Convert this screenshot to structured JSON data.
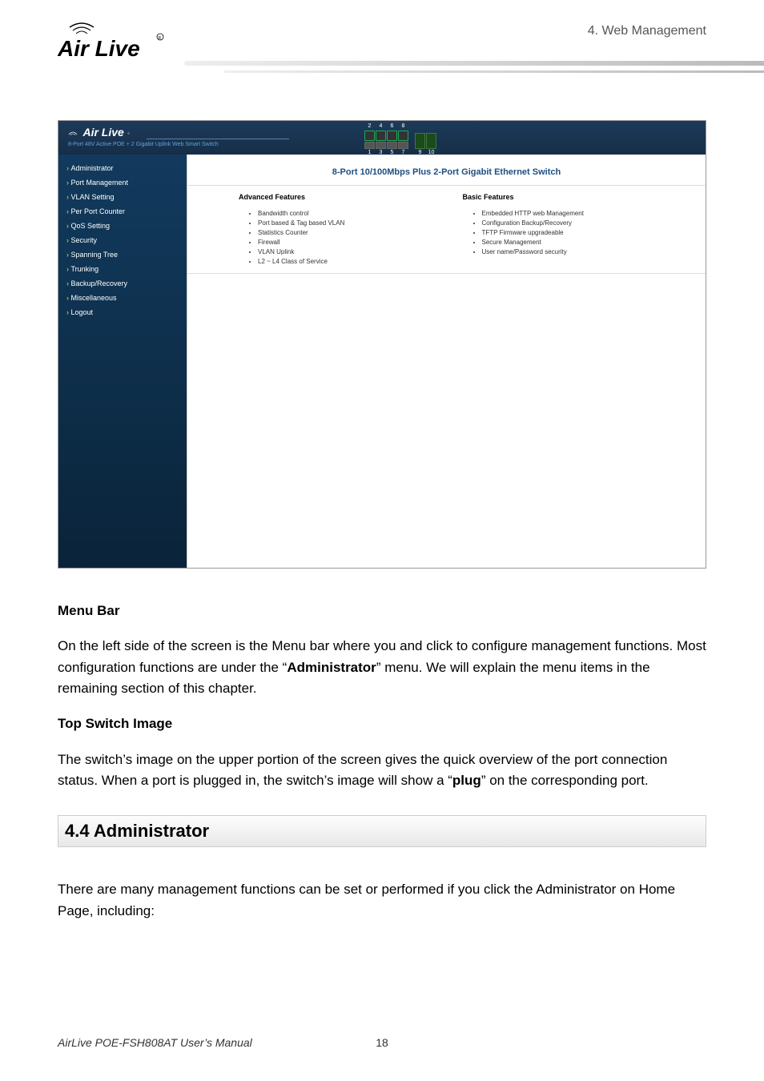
{
  "page_header": {
    "chapter": "4.  Web  Management",
    "logo_alt": "Air Live"
  },
  "screenshot": {
    "header": {
      "brand": "Air Live",
      "subtitle": "8-Port 48V Active POE + 2 Gigabit Uplink Web Smart Switch",
      "port_labels_top": [
        "2",
        "4",
        "6",
        "8"
      ],
      "port_labels_bottom": [
        "1",
        "3",
        "5",
        "7"
      ],
      "uplink_labels": [
        "9",
        "10"
      ]
    },
    "sidebar": {
      "items": [
        {
          "label": "Administrator"
        },
        {
          "label": "Port Management"
        },
        {
          "label": "VLAN Setting"
        },
        {
          "label": "Per Port Counter"
        },
        {
          "label": "QoS Setting"
        },
        {
          "label": "Security"
        },
        {
          "label": "Spanning Tree"
        },
        {
          "label": "Trunking"
        },
        {
          "label": "Backup/Recovery"
        },
        {
          "label": "Miscellaneous"
        },
        {
          "label": "Logout"
        }
      ]
    },
    "content": {
      "title": "8-Port 10/100Mbps Plus 2-Port Gigabit Ethernet Switch",
      "advanced": {
        "title": "Advanced Features",
        "items": [
          "Bandwidth control",
          "Port based & Tag based VLAN",
          "Statistics Counter",
          "Firewall",
          "VLAN Uplink",
          "L2 ~ L4 Class of Service"
        ]
      },
      "basic": {
        "title": "Basic Features",
        "items": [
          "Embedded HTTP web Management",
          "Configuration Backup/Recovery",
          "TFTP Firmware upgradeable",
          "Secure Management",
          "User name/Password security"
        ]
      }
    }
  },
  "body": {
    "menu_bar_heading": "Menu Bar",
    "menu_bar_p1a": "On the left side of the screen is the Menu bar where you and click to configure management functions. Most configuration functions are under the “",
    "menu_bar_p1b": "Administrator",
    "menu_bar_p1c": "” menu. We will explain the menu items in the remaining section of this chapter.",
    "top_switch_heading": "Top Switch Image",
    "top_switch_p1a": "The switch’s image on the upper portion of the screen gives the quick overview of the port connection status. When a port is plugged in, the switch’s image will show a “",
    "top_switch_p1b": "plug",
    "top_switch_p1c": "” on the corresponding port.",
    "section_heading": "4.4 Administrator",
    "admin_p1": "There are many management functions can be set or performed if you click the Administrator on Home Page, including:"
  },
  "footer": {
    "manual": "AirLive POE-FSH808AT User’s Manual",
    "page": "18"
  }
}
